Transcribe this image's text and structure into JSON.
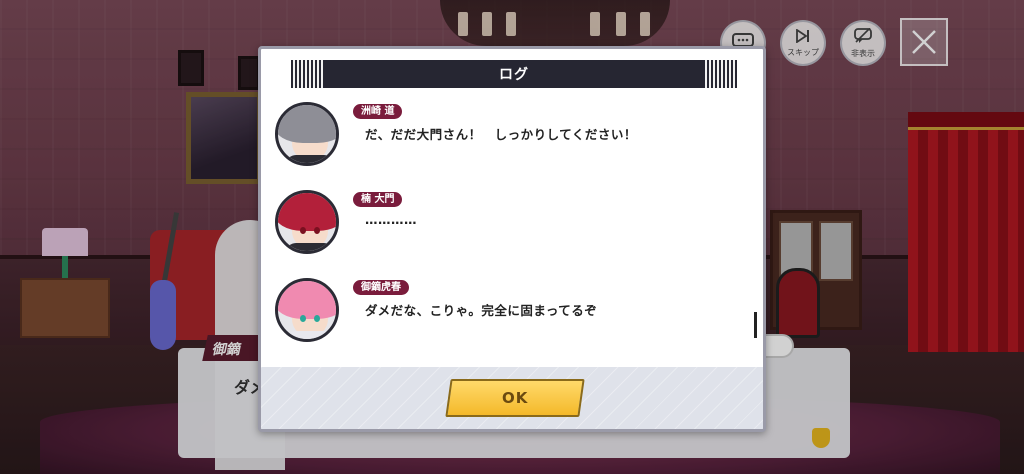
{
  "scene": {
    "background_speaker_prefix": "御鏑",
    "background_line_prefix": "ダメ"
  },
  "top_controls": {
    "log_icon": "chat-bubble-icon",
    "skip_label": "スキップ",
    "hide_label": "非表示",
    "close_icon": "close-x-icon"
  },
  "log_modal": {
    "title": "ログ",
    "entries": [
      {
        "speaker": "洲崎 道",
        "text": "だ、だだ大門さん！　しっかりしてください！",
        "avatar": "grey-hair"
      },
      {
        "speaker": "楠 大門",
        "text": "…………",
        "avatar": "red-hair"
      },
      {
        "speaker": "御鏑虎春",
        "text": "ダメだな、こりゃ。完全に固まってるぞ",
        "avatar": "pink-hair"
      }
    ],
    "ok_label": "OK"
  },
  "colors": {
    "name_tag": "#7a1c3c",
    "ok_button": "#f4b92a",
    "title_bar": "#262632"
  }
}
